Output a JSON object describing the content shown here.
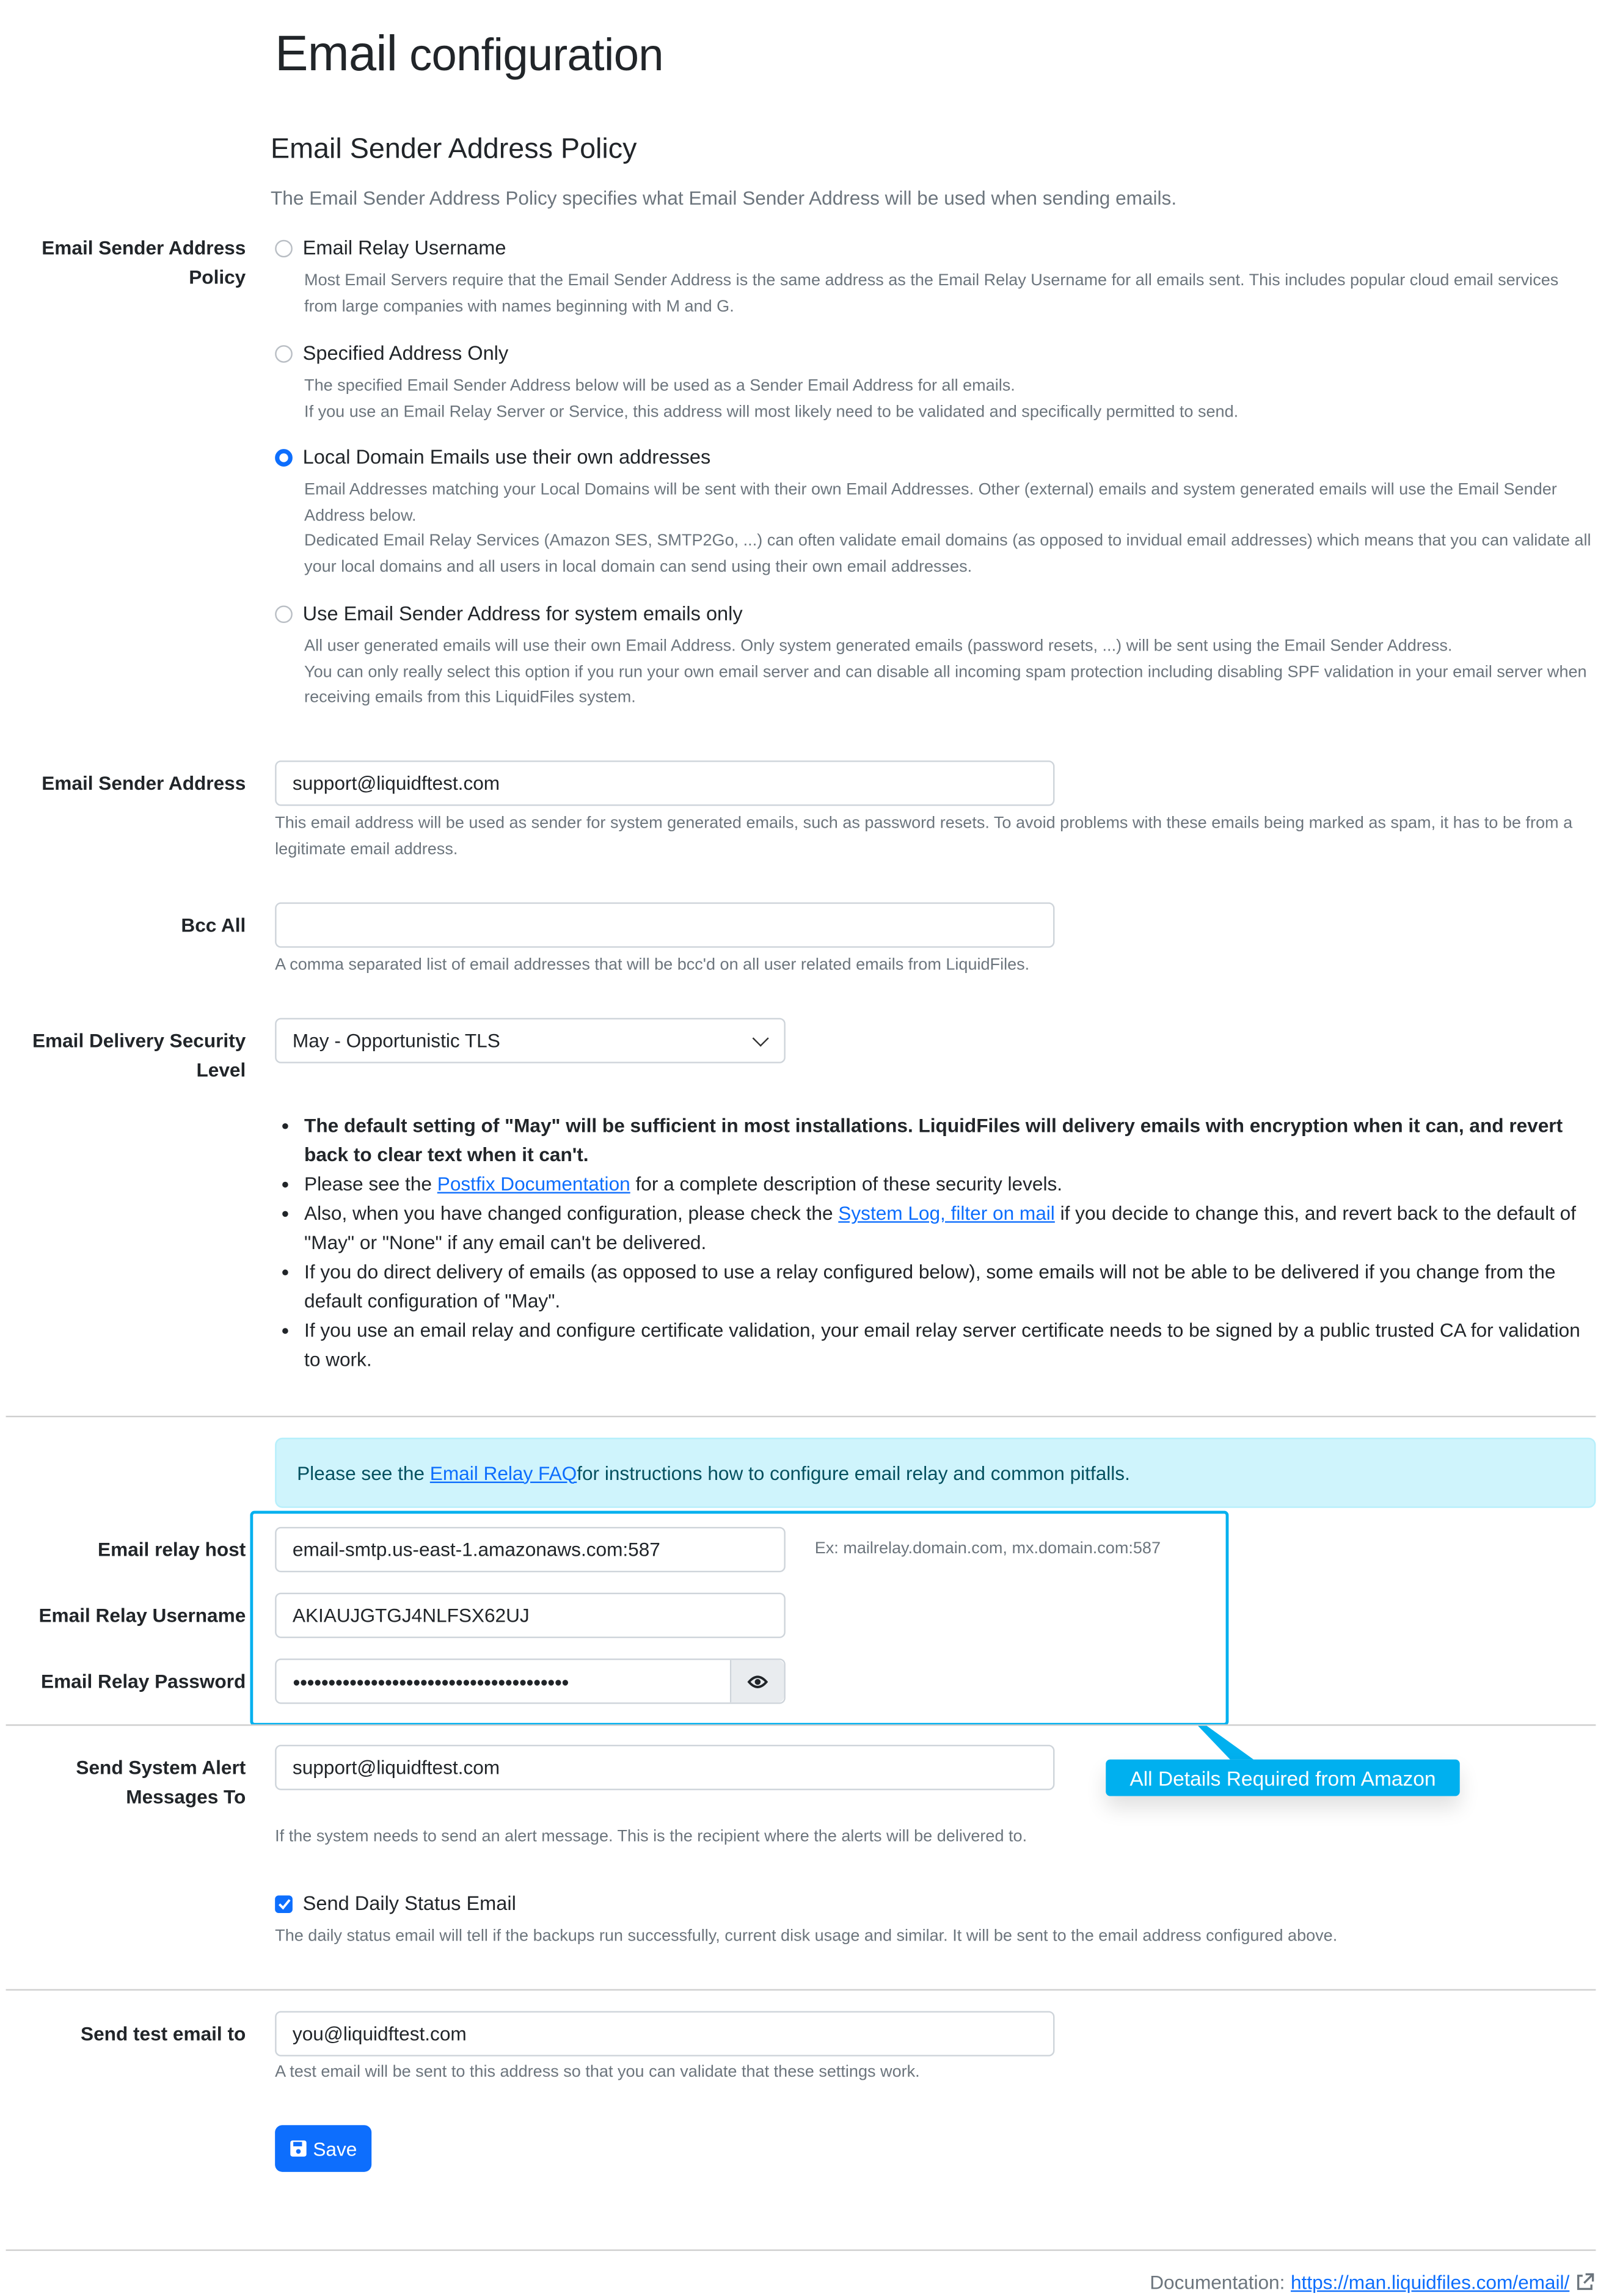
{
  "page": {
    "title_word1": "Email",
    "title_word2": "configuration"
  },
  "policy": {
    "heading": "Email Sender Address Policy",
    "lead": "The Email Sender Address Policy specifies what Email Sender Address will be used when sending emails.",
    "label_line1": "Email Sender Address",
    "label_line2": "Policy",
    "options": [
      {
        "label": "Email Relay Username",
        "selected": false,
        "help": [
          "Most Email Servers require that the Email Sender Address is the same address as the Email Relay Username for all emails sent. This includes popular cloud email services from large companies with names beginning with M and G."
        ]
      },
      {
        "label": "Specified Address Only",
        "selected": false,
        "help": [
          "The specified Email Sender Address below will be used as a Sender Email Address for all emails.",
          "If you use an Email Relay Server or Service, this address will most likely need to be validated and specifically permitted to send."
        ]
      },
      {
        "label": "Local Domain Emails use their own addresses",
        "selected": true,
        "help": [
          "Email Addresses matching your Local Domains will be sent with their own Email Addresses. Other (external) emails and system generated emails will use the Email Sender Address below.",
          "Dedicated Email Relay Services (Amazon SES, SMTP2Go, ...) can often validate email domains (as opposed to invidual email addresses) which means that you can validate all your local domains and all users in local domain can send using their own email addresses."
        ]
      },
      {
        "label": "Use Email Sender Address for system emails only",
        "selected": false,
        "help": [
          "All user generated emails will use their own Email Address. Only system generated emails (password resets, ...) will be sent using the Email Sender Address.",
          "You can only really select this option if you run your own email server and can disable all incoming spam protection including disabling SPF validation in your email server when receiving emails from this LiquidFiles system."
        ]
      }
    ]
  },
  "sender_address": {
    "label": "Email Sender Address",
    "value": "support@liquidftest.com",
    "help": "This email address will be used as sender for system generated emails, such as password resets. To avoid problems with these emails being marked as spam, it has to be from a legitimate email address."
  },
  "bcc_all": {
    "label": "Bcc All",
    "value": "",
    "help": "A comma separated list of email addresses that will be bcc'd on all user related emails from LiquidFiles."
  },
  "delivery_security": {
    "label_line1": "Email Delivery Security",
    "label_line2": "Level",
    "selected": "May - Opportunistic TLS",
    "bullets": {
      "b1": "The default setting of \"May\" will be sufficient in most installations. LiquidFiles will delivery emails with encryption when it can, and revert back to clear text when it can't.",
      "b2_pre": "Please see the ",
      "b2_link": "Postfix Documentation",
      "b2_post": " for a complete description of these security levels.",
      "b3_pre": "Also, when you have changed configuration, please check the ",
      "b3_link": "System Log, filter on mail",
      "b3_post": " if you decide to change this, and revert back to the default of \"May\" or \"None\" if any email can't be delivered.",
      "b4": "If you do direct delivery of emails (as opposed to use a relay configured below), some emails will not be able to be delivered if you change from the default configuration of \"May\".",
      "b5": "If you use an email relay and configure certificate validation, your email relay server certificate needs to be signed by a public trusted CA for validation to work."
    }
  },
  "relay_alert": {
    "pre": "Please see the ",
    "link": "Email Relay FAQ",
    "post": " for instructions how to configure email relay and common pitfalls."
  },
  "relay": {
    "host_label": "Email relay host",
    "host_value": "email-smtp.us-east-1.amazonaws.com:587",
    "host_hint": "Ex: mailrelay.domain.com, mx.domain.com:587",
    "username_label": "Email Relay Username",
    "username_value": "AKIAUJGTGJ4NLFSX62UJ",
    "password_label": "Email Relay Password",
    "password_masked": "●●●●●●●●●●●●●●●●●●●●●●●●●●●●●●●●●●●●●●●",
    "toggle_icon": "eye-icon"
  },
  "annotation": {
    "text": "All Details Required from Amazon",
    "color": "#00b0ef"
  },
  "alerts_to": {
    "label_line1": "Send System Alert",
    "label_line2": "Messages To",
    "value": "support@liquidftest.com",
    "help": "If the system needs to send an alert message. This is the recipient where the alerts will be delivered to."
  },
  "daily_status": {
    "label": "Send Daily Status Email",
    "checked": true,
    "help": "The daily status email will tell if the backups run successfully, current disk usage and similar. It will be sent to the email address configured above."
  },
  "test_email": {
    "label": "Send test email to",
    "value": "you@liquidftest.com",
    "help": "A test email will be sent to this address so that you can validate that these settings work."
  },
  "save_button": {
    "label": "Save",
    "icon": "floppy-disk-icon",
    "color": "#0d6efd"
  },
  "footer": {
    "prefix": "Documentation: ",
    "link": "https://man.liquidfiles.com/email/",
    "icon": "external-link-icon"
  }
}
